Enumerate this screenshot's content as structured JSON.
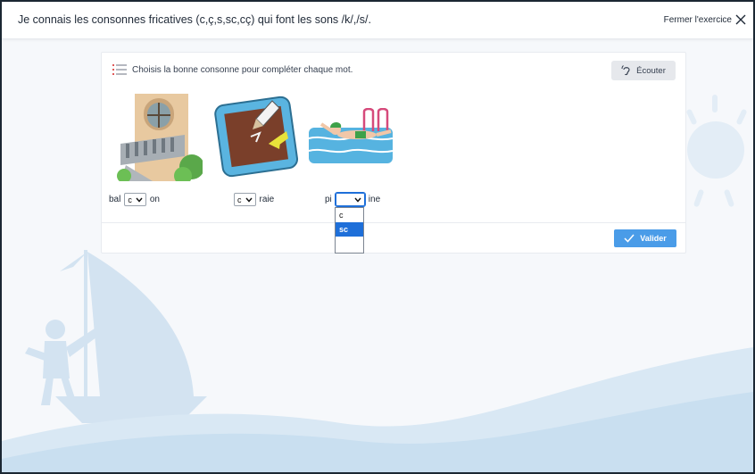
{
  "header": {
    "title": "Je connais les consonnes fricatives (c,ç,s,sc,cç) qui font les sons /k/,/s/.",
    "close_label": "Fermer l'exercice"
  },
  "exercise": {
    "instruction": "Choisis la bonne consonne pour compléter chaque mot.",
    "listen_label": "Écouter",
    "items": [
      {
        "prefix": "bal",
        "selected": "c",
        "suffix": "on"
      },
      {
        "prefix": "",
        "selected": "c",
        "suffix": "raie"
      },
      {
        "prefix": "pi",
        "selected": "",
        "suffix": "ine"
      }
    ],
    "dropdown_options": [
      "c",
      "sc",
      ""
    ],
    "dropdown_highlighted": "sc",
    "validate_label": "Valider"
  },
  "colors": {
    "accent": "#4a9ce8",
    "select_focus": "#1e6fd9",
    "wave": "#c9dff0",
    "sun": "#e3edf6"
  }
}
